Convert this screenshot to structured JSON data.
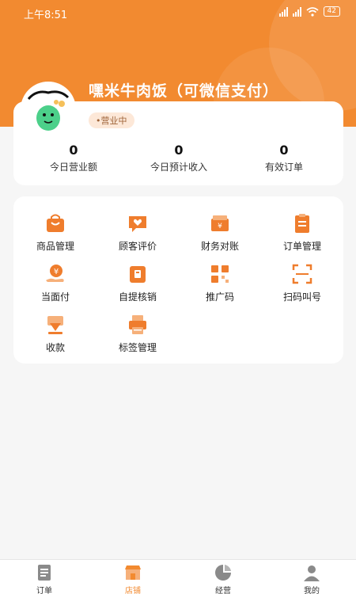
{
  "status_bar": {
    "time": "上午8:51",
    "battery": "42"
  },
  "store": {
    "name": "嘿米牛肉饭（可微信支付）",
    "status": "•营业中"
  },
  "stats": [
    {
      "value": "0",
      "label": "今日营业额"
    },
    {
      "value": "0",
      "label": "今日预计收入"
    },
    {
      "value": "0",
      "label": "有效订单"
    }
  ],
  "menu": [
    {
      "label": "商品管理",
      "icon": "shopping-bag-icon"
    },
    {
      "label": "顾客评价",
      "icon": "heart-chat-icon"
    },
    {
      "label": "财务对账",
      "icon": "wallet-icon"
    },
    {
      "label": "订单管理",
      "icon": "clipboard-icon"
    },
    {
      "label": "当面付",
      "icon": "hand-coin-icon"
    },
    {
      "label": "自提核销",
      "icon": "pickup-icon"
    },
    {
      "label": "推广码",
      "icon": "qr-code-icon"
    },
    {
      "label": "扫码叫号",
      "icon": "scan-icon"
    },
    {
      "label": "收款",
      "icon": "receive-money-icon"
    },
    {
      "label": "标签管理",
      "icon": "printer-icon"
    }
  ],
  "tabs": [
    {
      "label": "订单",
      "icon": "order-list-icon",
      "active": false
    },
    {
      "label": "店铺",
      "icon": "store-icon",
      "active": true
    },
    {
      "label": "经营",
      "icon": "pie-chart-icon",
      "active": false
    },
    {
      "label": "我的",
      "icon": "profile-icon",
      "active": false
    }
  ],
  "colors": {
    "accent": "#f28a30",
    "icon_orange": "#ef7d2d",
    "icon_gray": "#8a8a8a"
  }
}
